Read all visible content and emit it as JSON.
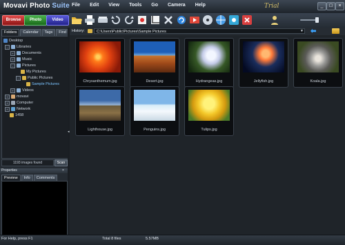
{
  "app": {
    "title_main": "Movavi Photo",
    "title_suite": "Suite",
    "trial_label": "Trial"
  },
  "menu": [
    "File",
    "Edit",
    "View",
    "Tools",
    "Go",
    "Camera",
    "Help"
  ],
  "window_controls": {
    "minimize": "_",
    "maximize": "□",
    "close": "×"
  },
  "modes": {
    "browse": "Browse",
    "photo": "Photo",
    "video": "Video"
  },
  "toolbar_icons": [
    "open-folder-icon",
    "print-icon",
    "scanner-icon",
    "rotate-left-icon",
    "rotate-right-icon",
    "red-eye-icon",
    "crop-icon",
    "delete-icon",
    "refresh-icon",
    "slideshow-icon",
    "cd-icon",
    "web-icon",
    "settings-icon",
    "close-icon"
  ],
  "left_tabs": [
    "Folders",
    "Calendar",
    "Tags",
    "Find"
  ],
  "tree": [
    {
      "label": "Desktop",
      "icon": "desktop-icon",
      "toggle": ""
    },
    {
      "label": "Libraries",
      "icon": "library-icon",
      "toggle": "-"
    },
    {
      "label": "Documents",
      "icon": "library-icon",
      "toggle": "+"
    },
    {
      "label": "Music",
      "icon": "library-icon",
      "toggle": "+"
    },
    {
      "label": "Pictures",
      "icon": "library-icon",
      "toggle": "-"
    },
    {
      "label": "My Pictures",
      "icon": "folder-icon",
      "toggle": ""
    },
    {
      "label": "Public Pictures",
      "icon": "folder-icon",
      "toggle": "-"
    },
    {
      "label": "Sample Pictures",
      "icon": "folder-icon",
      "toggle": "",
      "selected": true
    },
    {
      "label": "Videos",
      "icon": "library-icon",
      "toggle": "+"
    },
    {
      "label": "movavi",
      "icon": "user-icon",
      "toggle": "+"
    },
    {
      "label": "Computer",
      "icon": "computer-icon",
      "toggle": "+"
    },
    {
      "label": "Network",
      "icon": "network-icon",
      "toggle": "+"
    },
    {
      "label": "1458",
      "icon": "folder-icon",
      "toggle": ""
    }
  ],
  "images_found": "1193 images found",
  "scan_label": "Scan",
  "properties": {
    "title": "Properties",
    "close": "×",
    "tabs": [
      "Preview",
      "Info",
      "Comments"
    ]
  },
  "history": {
    "label": "History:",
    "path": "C:\\Users\\Public\\Pictures\\Sample Pictures",
    "dropdown": "▼"
  },
  "thumbnails": [
    {
      "name": "Chrysanthemum.jpg",
      "art": "chrysanthemum"
    },
    {
      "name": "Desert.jpg",
      "art": "desert"
    },
    {
      "name": "Hydrangeas.jpg",
      "art": "hydrangeas"
    },
    {
      "name": "Jellyfish.jpg",
      "art": "jellyfish"
    },
    {
      "name": "Koala.jpg",
      "art": "koala"
    },
    {
      "name": "Lighthouse.jpg",
      "art": "lighthouse"
    },
    {
      "name": "Penguins.jpg",
      "art": "penguins"
    },
    {
      "name": "Tulips.jpg",
      "art": "tulips"
    }
  ],
  "status": {
    "help": "For Help, press F1",
    "total": "Total 8 files",
    "size": "5.57MB"
  }
}
